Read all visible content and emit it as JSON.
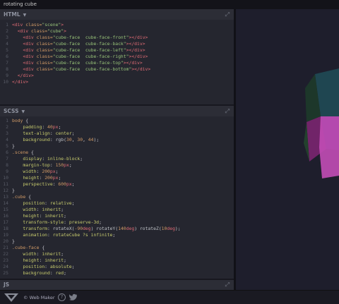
{
  "window": {
    "title": "rotating cube"
  },
  "html_panel": {
    "title": "HTML",
    "lines": [
      [
        [
          "t",
          "<div "
        ],
        [
          "a",
          "class="
        ],
        [
          "s",
          "\"scene\""
        ],
        [
          "t",
          ">"
        ]
      ],
      [
        [
          "p",
          "  "
        ],
        [
          "t",
          "<div "
        ],
        [
          "a",
          "class="
        ],
        [
          "s",
          "\"cube\""
        ],
        [
          "t",
          ">"
        ]
      ],
      [
        [
          "p",
          "    "
        ],
        [
          "t",
          "<div "
        ],
        [
          "a",
          "class="
        ],
        [
          "s",
          "\"cube-face  cube-face-front\""
        ],
        [
          "t",
          "></div>"
        ]
      ],
      [
        [
          "p",
          "    "
        ],
        [
          "t",
          "<div "
        ],
        [
          "a",
          "class="
        ],
        [
          "s",
          "\"cube-face  cube-face-back\""
        ],
        [
          "t",
          "></div>"
        ]
      ],
      [
        [
          "p",
          "    "
        ],
        [
          "t",
          "<div "
        ],
        [
          "a",
          "class="
        ],
        [
          "s",
          "\"cube-face  cube-face-left\""
        ],
        [
          "t",
          "></div>"
        ]
      ],
      [
        [
          "p",
          "    "
        ],
        [
          "t",
          "<div "
        ],
        [
          "a",
          "class="
        ],
        [
          "s",
          "\"cube-face  cube-face-right\""
        ],
        [
          "t",
          "></div>"
        ]
      ],
      [
        [
          "p",
          "    "
        ],
        [
          "t",
          "<div "
        ],
        [
          "a",
          "class="
        ],
        [
          "s",
          "\"cube-face  cube-face-top\""
        ],
        [
          "t",
          "></div>"
        ]
      ],
      [
        [
          "p",
          "    "
        ],
        [
          "t",
          "<div "
        ],
        [
          "a",
          "class="
        ],
        [
          "s",
          "\"cube-face  cube-face-bottom\""
        ],
        [
          "t",
          "></div>"
        ]
      ],
      [
        [
          "p",
          "  "
        ],
        [
          "t",
          "</div>"
        ]
      ],
      [
        [
          "t",
          "</div>"
        ]
      ]
    ]
  },
  "scss_panel": {
    "title": "SCSS",
    "lines": [
      [
        [
          "sel",
          "body "
        ],
        [
          "p",
          "{"
        ]
      ],
      [
        [
          "p",
          "    "
        ],
        [
          "prop",
          "padding"
        ],
        [
          "p",
          ": "
        ],
        [
          "num",
          "40"
        ],
        [
          "unit",
          "px"
        ],
        [
          "p",
          ";"
        ]
      ],
      [
        [
          "p",
          "    "
        ],
        [
          "prop",
          "text-align"
        ],
        [
          "p",
          ": "
        ],
        [
          "val",
          "center"
        ],
        [
          "p",
          ";"
        ]
      ],
      [
        [
          "p",
          "    "
        ],
        [
          "prop",
          "background"
        ],
        [
          "p",
          ": "
        ],
        [
          "fn",
          "rgb("
        ],
        [
          "num",
          "30"
        ],
        [
          "p",
          ", "
        ],
        [
          "num",
          "30"
        ],
        [
          "p",
          ", "
        ],
        [
          "num",
          "44"
        ],
        [
          "fn",
          ")"
        ],
        [
          "p",
          ";"
        ]
      ],
      [
        [
          "p",
          "}"
        ]
      ],
      [
        [
          "sel",
          ".scene "
        ],
        [
          "p",
          "{"
        ]
      ],
      [
        [
          "p",
          "    "
        ],
        [
          "prop",
          "display"
        ],
        [
          "p",
          ": "
        ],
        [
          "val",
          "inline-block"
        ],
        [
          "p",
          ";"
        ]
      ],
      [
        [
          "p",
          "    "
        ],
        [
          "prop",
          "margin-top"
        ],
        [
          "p",
          ": "
        ],
        [
          "num",
          "150"
        ],
        [
          "unit",
          "px"
        ],
        [
          "p",
          ";"
        ]
      ],
      [
        [
          "p",
          "    "
        ],
        [
          "prop",
          "width"
        ],
        [
          "p",
          ": "
        ],
        [
          "num",
          "200"
        ],
        [
          "unit",
          "px"
        ],
        [
          "p",
          ";"
        ]
      ],
      [
        [
          "p",
          "    "
        ],
        [
          "prop",
          "height"
        ],
        [
          "p",
          ": "
        ],
        [
          "num",
          "200"
        ],
        [
          "unit",
          "px"
        ],
        [
          "p",
          ";"
        ]
      ],
      [
        [
          "p",
          "    "
        ],
        [
          "prop",
          "perspective"
        ],
        [
          "p",
          ": "
        ],
        [
          "num",
          "600"
        ],
        [
          "unit",
          "px"
        ],
        [
          "p",
          ";"
        ]
      ],
      [
        [
          "p",
          "}"
        ]
      ],
      [
        [
          "sel",
          ".cube "
        ],
        [
          "p",
          "{"
        ]
      ],
      [
        [
          "p",
          "    "
        ],
        [
          "prop",
          "position"
        ],
        [
          "p",
          ": "
        ],
        [
          "val",
          "relative"
        ],
        [
          "p",
          ";"
        ]
      ],
      [
        [
          "p",
          "    "
        ],
        [
          "prop",
          "width"
        ],
        [
          "p",
          ": "
        ],
        [
          "val",
          "inherit"
        ],
        [
          "p",
          ";"
        ]
      ],
      [
        [
          "p",
          "    "
        ],
        [
          "prop",
          "height"
        ],
        [
          "p",
          ": "
        ],
        [
          "val",
          "inherit"
        ],
        [
          "p",
          ";"
        ]
      ],
      [
        [
          "p",
          "    "
        ],
        [
          "prop",
          "transform-style"
        ],
        [
          "p",
          ": "
        ],
        [
          "val",
          "preserve-3d"
        ],
        [
          "p",
          ";"
        ]
      ],
      [
        [
          "p",
          "    "
        ],
        [
          "prop",
          "transform"
        ],
        [
          "p",
          ": "
        ],
        [
          "fn",
          "rotateX("
        ],
        [
          "num",
          "-90"
        ],
        [
          "unit",
          "deg"
        ],
        [
          "fn",
          ") rotateY("
        ],
        [
          "num",
          "140"
        ],
        [
          "unit",
          "deg"
        ],
        [
          "fn",
          ") rotateZ("
        ],
        [
          "num",
          "10"
        ],
        [
          "unit",
          "deg"
        ],
        [
          "fn",
          ")"
        ],
        [
          "p",
          ";"
        ]
      ],
      [
        [
          "p",
          "    "
        ],
        [
          "prop",
          "animation"
        ],
        [
          "p",
          ": "
        ],
        [
          "val",
          "rotateCube ?s infinite"
        ],
        [
          "p",
          ";"
        ]
      ],
      [
        [
          "p",
          "}"
        ]
      ],
      [
        [
          "sel",
          ".cube-face "
        ],
        [
          "p",
          "{"
        ]
      ],
      [
        [
          "p",
          "    "
        ],
        [
          "prop",
          "width"
        ],
        [
          "p",
          ": "
        ],
        [
          "val",
          "inherit"
        ],
        [
          "p",
          ";"
        ]
      ],
      [
        [
          "p",
          "    "
        ],
        [
          "prop",
          "height"
        ],
        [
          "p",
          ": "
        ],
        [
          "val",
          "inherit"
        ],
        [
          "p",
          ";"
        ]
      ],
      [
        [
          "p",
          "    "
        ],
        [
          "prop",
          "position"
        ],
        [
          "p",
          ": "
        ],
        [
          "val",
          "absolute"
        ],
        [
          "p",
          ";"
        ]
      ],
      [
        [
          "p",
          "    "
        ],
        [
          "prop",
          "background"
        ],
        [
          "p",
          ": "
        ],
        [
          "val",
          "red"
        ],
        [
          "p",
          ";"
        ]
      ]
    ]
  },
  "js_panel": {
    "title": "JS"
  },
  "footer": {
    "brand": "© Web Maker",
    "help": "?"
  },
  "preview": {
    "cube_colors": [
      "#1f4a55",
      "#3a2d6a",
      "#1d3a2a",
      "#7a2570",
      "#24452e",
      "#c24cb6"
    ]
  }
}
